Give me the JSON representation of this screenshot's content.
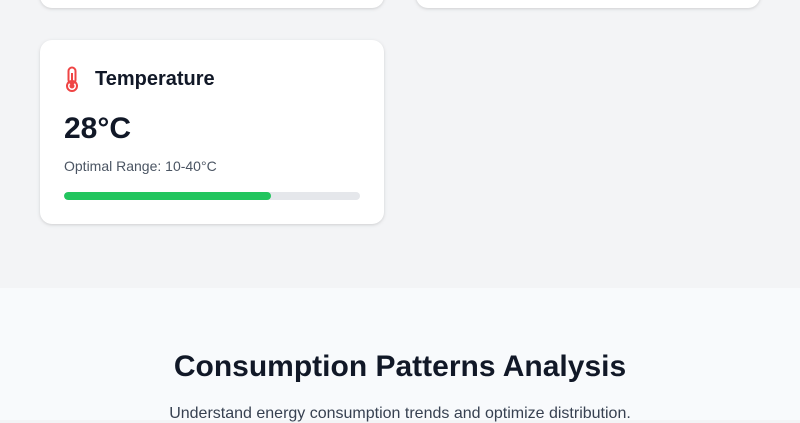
{
  "metrics": {
    "temperature": {
      "title": "Temperature",
      "icon": "thermometer-icon",
      "icon_color": "#ef4444",
      "value": "28°C",
      "range_label": "Optimal Range: 10-40°C",
      "progress_fraction": 0.7,
      "progress_color": "#22c55e"
    }
  },
  "analysis": {
    "title": "Consumption Patterns Analysis",
    "subtitle": "Understand energy consumption trends and optimize distribution."
  }
}
